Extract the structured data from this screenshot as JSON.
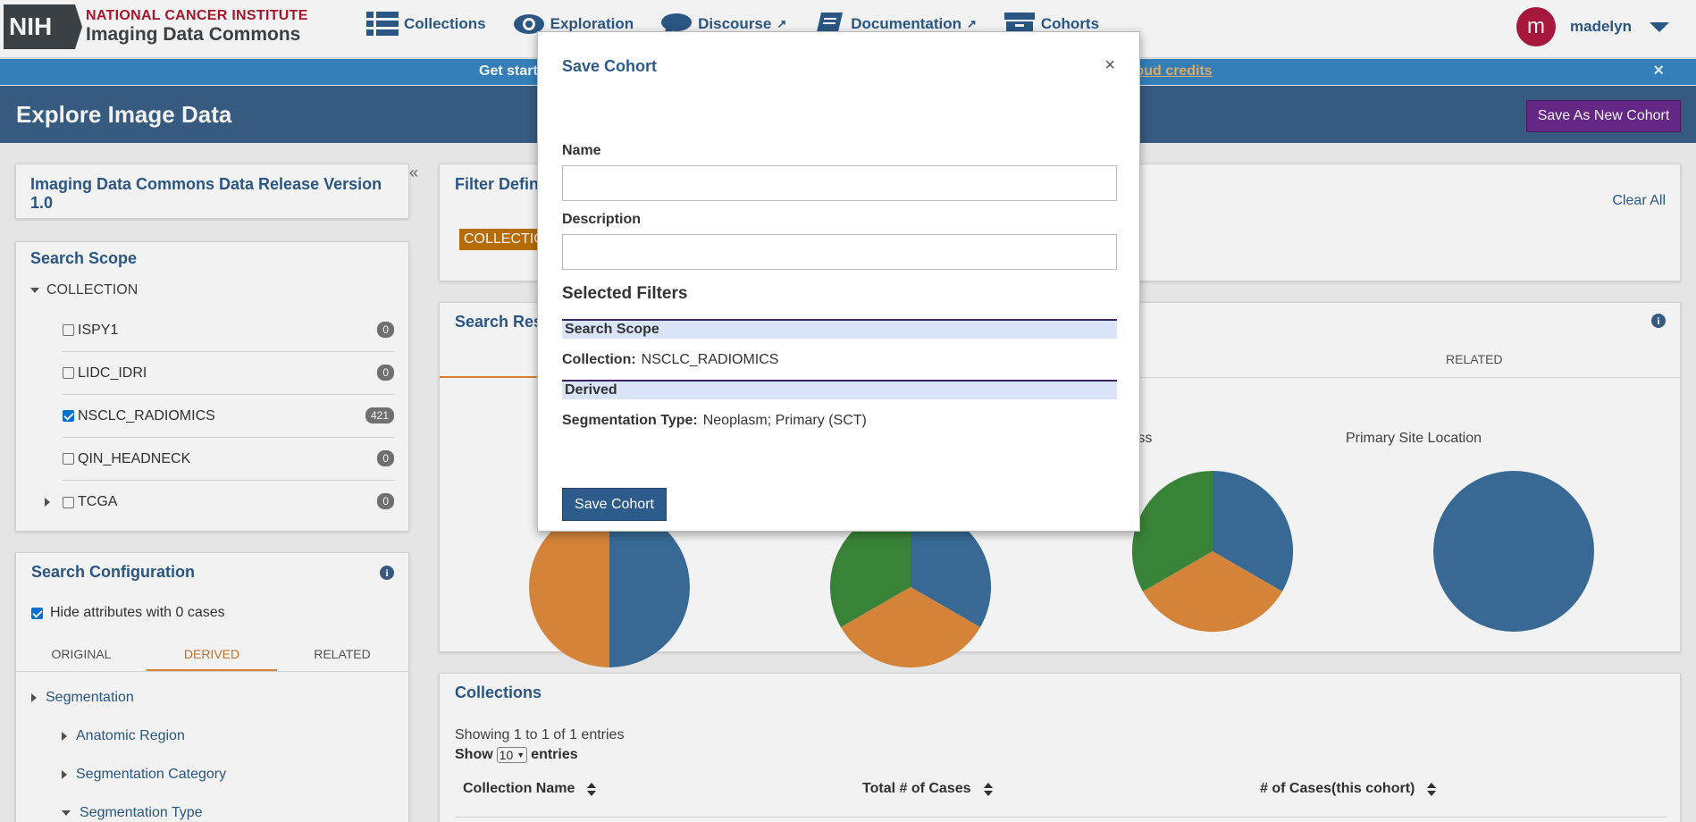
{
  "logo": {
    "badge": "NIH",
    "line1": "NATIONAL CANCER INSTITUTE",
    "line2": "Imaging Data Commons"
  },
  "nav": [
    {
      "label": "Collections",
      "icon": "list-icon"
    },
    {
      "label": "Exploration",
      "icon": "eye-icon"
    },
    {
      "label": "Discourse",
      "icon": "chat-bubble-icon"
    },
    {
      "label": "Documentation",
      "icon": "book-icon"
    },
    {
      "label": "Cohorts",
      "icon": "archive-box-icon"
    }
  ],
  "user": {
    "initial": "m",
    "name": "madelyn"
  },
  "banner": {
    "text": "Get start",
    "link": "loud credits",
    "close": "×"
  },
  "page": {
    "title": "Explore Image Data",
    "save_new": "Save As New Cohort"
  },
  "sidebar": {
    "collapse": "«",
    "release": "Imaging Data Commons Data Release Version 1.0",
    "scope": {
      "title": "Search Scope",
      "collection_label": "COLLECTION",
      "items": [
        {
          "label": "ISPY1",
          "count": "0",
          "checked": false
        },
        {
          "label": "LIDC_IDRI",
          "count": "0",
          "checked": false
        },
        {
          "label": "NSCLC_RADIOMICS",
          "count": "421",
          "checked": true
        },
        {
          "label": "QIN_HEADNECK",
          "count": "0",
          "checked": false
        },
        {
          "label": "TCGA",
          "count": "0",
          "checked": false
        }
      ]
    },
    "config": {
      "title": "Search Configuration",
      "hide_zero": "Hide attributes with 0 cases",
      "tabs": [
        "ORIGINAL",
        "DERIVED",
        "RELATED"
      ],
      "tree": [
        "Segmentation",
        "Anatomic Region",
        "Segmentation Category",
        "Segmentation Type"
      ]
    }
  },
  "filter": {
    "title": "Filter Defin",
    "clear_all": "Clear All",
    "tag": "COLLECTIC"
  },
  "results": {
    "title": "Search Res",
    "related_tab": "RELATED",
    "charts": [
      {
        "label": "Object Class"
      },
      {
        "label": "Primary Site Location"
      }
    ],
    "colors": {
      "blue": "#3a6f9c",
      "orange": "#e08b3c",
      "green": "#3d8b3d"
    }
  },
  "collections": {
    "title": "Collections",
    "showing": "Showing 1 to 1 of 1 entries",
    "show": "Show",
    "page_size": "10",
    "entries": "entries",
    "columns": [
      "Collection Name",
      "Total # of Cases",
      "# of Cases(this cohort)"
    ]
  },
  "modal": {
    "title": "Save Cohort",
    "close": "×",
    "name_label": "Name",
    "description_label": "Description",
    "selected_filters": "Selected Filters",
    "sections": [
      {
        "header": "Search Scope",
        "key": "Collection:",
        "value": "NSCLC_RADIOMICS"
      },
      {
        "header": "Derived",
        "key": "Segmentation Type:",
        "value": "Neoplasm; Primary (SCT)"
      }
    ],
    "save_button": "Save Cohort"
  }
}
